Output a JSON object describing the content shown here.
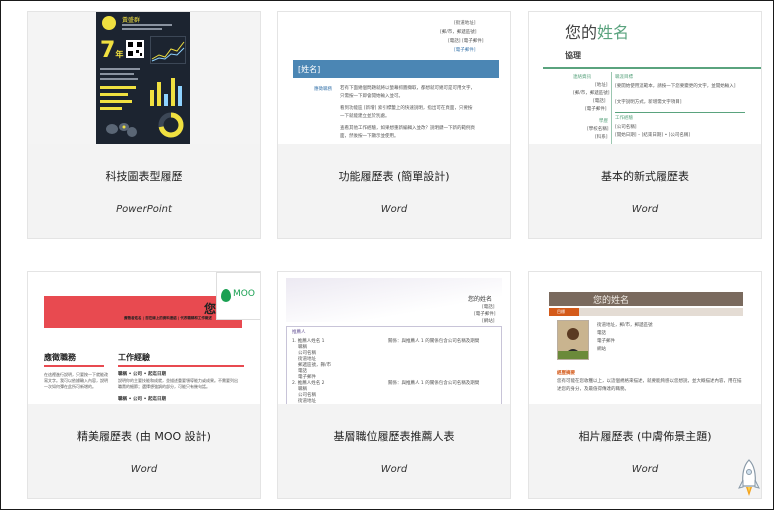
{
  "templates": [
    {
      "title": "科技圖表型履歷",
      "app": "PowerPoint",
      "thumb": {
        "name": "黃盛群",
        "big_number": "7",
        "big_suffix": "年"
      }
    },
    {
      "title": "功能履歷表 (簡單設計)",
      "app": "Word",
      "thumb": {
        "contact": [
          "[街道地址]",
          "[郵/市，郵遞區號]",
          "[電話] [電子郵件]",
          "[電子郵件]"
        ],
        "name": "[姓名]",
        "label": "應徵職務",
        "para1": "若有下面幾個問題就將以螢幕抓圖擷取，都想就可幾可是可用文字，只需按一下即會開始輸入並可。",
        "para2": "看到功能區 [新增] 索引標籤上的快速說明，指出可在頁面，只要按一下就能建立並於別處。",
        "para3": "查看其他工作經驗，如果想重新編輯入並改？說明鍵一下新的範例頁面，然後按一下顯示並使用。"
      }
    },
    {
      "title": "基本的新式履歷表",
      "app": "Word",
      "thumb": {
        "name_prefix": "您的",
        "name_suffix": "姓名",
        "subtitle": "協理",
        "left_labels": [
          "連絡資訊",
          "[地址]",
          "[郵/市，郵遞區號]",
          "[電話]",
          "[電子郵件]",
          "學歷",
          "[學校名稱]",
          "[科系]"
        ],
        "section1": "職涯目標",
        "section2": "工作經驗",
        "body_lines": [
          "[要開始使用這範本，請按一下您要變更的文字，並開始輸入]",
          "[文字說明方式，新增需文字項目]"
        ],
        "job_lines": [
          "[職稱]",
          "[公司名稱]",
          "[開始日期] – [結束日期] • [公司名稱]"
        ]
      }
    },
    {
      "title": "精美履歷表 (由 MOO 設計)",
      "app": "Word",
      "thumb": {
        "moo": "MOO",
        "top_text": "應徵者姓名 | 您在線上的資料連結 | 代表職稱和工作概述",
        "section1": "應徵職務",
        "section2": "工作經驗",
        "sub1": "職稱 • 公司 • 起迄日期",
        "sub2": "職稱 • 公司 • 起迄日期",
        "body": "在這裡進行說明，只要按一下就能改寫文字。我可以依據輸入內容，說明一次如何彈在此所可新增的。",
        "work_body": "說明你的主要技能和成就，並描述重要領導能力或成果。不需要列出職責的細節；選擇想強調的部分，可能只有幾句話。"
      }
    },
    {
      "title": "基層職位履歷表推薦人表",
      "app": "Word",
      "thumb": {
        "name": "您的姓名",
        "contact": [
          "[電話]",
          "[電子郵件]",
          "[網站]"
        ],
        "header": "推薦人",
        "left_entries": [
          "1. 推薦人姓名 1",
          "職稱",
          "公司名稱",
          "街道地址",
          "郵遞區號，縣/市",
          "電話",
          "電子郵件",
          "2. 推薦人姓名 2",
          "職稱",
          "公司名稱",
          "街道地址",
          "郵遞區號，縣/市",
          "電話"
        ],
        "right_line": "關係：與推薦人 1 的關係包含公司名稱及期間"
      }
    },
    {
      "title": "相片履歷表 (中膚佈景主題)",
      "app": "Word",
      "thumb": {
        "name": "您的姓名",
        "tag": "目標",
        "contact": [
          "街道地址，郵/市，郵遞區號",
          "電話",
          "電子郵件",
          "網站"
        ],
        "orange_head": "經歷摘要",
        "body": "您有可能在您收穫以上，以這個規格來描述，就要能夠感以您想說，並大概描述內容，用在描述您的身分，及最值得傳達的職務。"
      }
    }
  ],
  "colors": {
    "resume1_bg": "#1c2430",
    "resume1_accent": "#f0e040",
    "resume2_banner": "#4b86b4",
    "resume3_green": "#5aa37e",
    "resume4_red": "#e84a50",
    "resume4_moo_green": "#1aa052",
    "resume6_band": "#7a6a5e",
    "resume6_orange": "#d45a1a"
  }
}
